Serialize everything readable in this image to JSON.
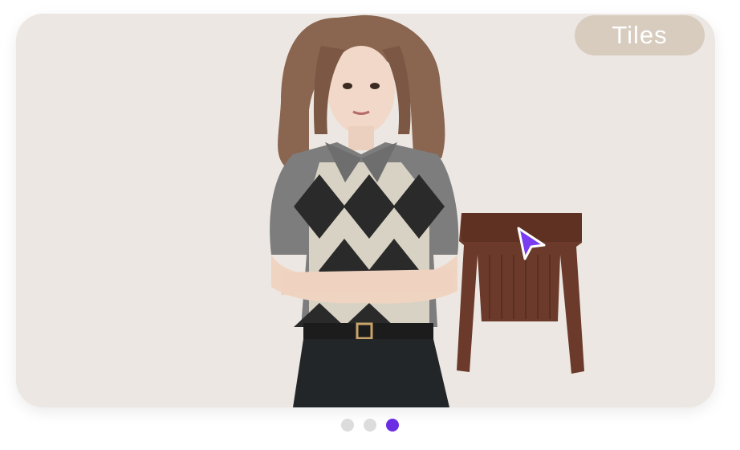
{
  "carousel": {
    "badge_label": "Tiles",
    "slide_count": 3,
    "active_index": 2
  },
  "colors": {
    "card_background": "#ece7e2",
    "badge_background": "#d8ccbf",
    "dot_inactive": "#dcdcdc",
    "dot_active": "#6a2de3",
    "cursor": "#7a3cf0"
  },
  "icons": {
    "pointer": "cursor-arrow-icon"
  }
}
